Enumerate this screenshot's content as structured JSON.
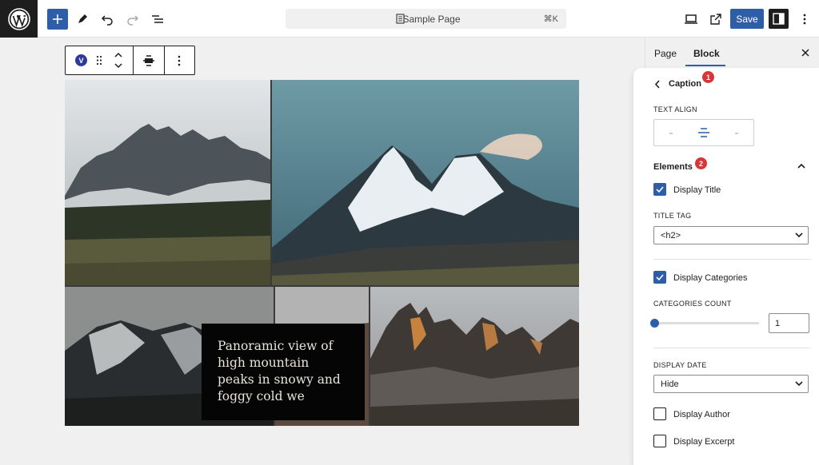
{
  "topbar": {
    "document_title": "Sample Page",
    "shortcut": "⌘K",
    "save_label": "Save",
    "icons": [
      "wordpress-logo",
      "plus-icon",
      "pen-icon",
      "undo-icon",
      "redo-icon",
      "list-view-icon",
      "document-icon",
      "desktop-preview-icon",
      "external-link-icon",
      "settings-panel-icon",
      "more-vertical-icon"
    ]
  },
  "block_toolbar": {
    "block_badge": "V",
    "icons": [
      "drag-handle-icon",
      "move-up-icon",
      "move-down-icon",
      "align-center-icon",
      "more-vertical-icon"
    ]
  },
  "gallery": {
    "caption": "Panoramic view of high mountain peaks in snowy and foggy cold we"
  },
  "sidebar": {
    "tabs": [
      {
        "label": "Page",
        "active": false
      },
      {
        "label": "Block",
        "active": true
      }
    ],
    "accent_color": "#2f5ea8",
    "panel": {
      "back_title": "Caption",
      "badge_1": "1",
      "text_align_label": "TEXT ALIGN",
      "text_align_selected": "center",
      "elements_label": "Elements",
      "badge_2": "2",
      "display_title_label": "Display Title",
      "display_title_checked": true,
      "title_tag_label": "TITLE TAG",
      "title_tag_value": "<h2>",
      "display_categories_label": "Display Categories",
      "display_categories_checked": true,
      "categories_count_label": "CATEGORIES COUNT",
      "categories_count_value": "1",
      "categories_count_slider": 0.0,
      "display_date_label": "DISPLAY DATE",
      "display_date_value": "Hide",
      "display_author_label": "Display Author",
      "display_author_checked": false,
      "display_excerpt_label": "Display Excerpt",
      "display_excerpt_checked": false
    },
    "badge_color": "#d63638"
  }
}
